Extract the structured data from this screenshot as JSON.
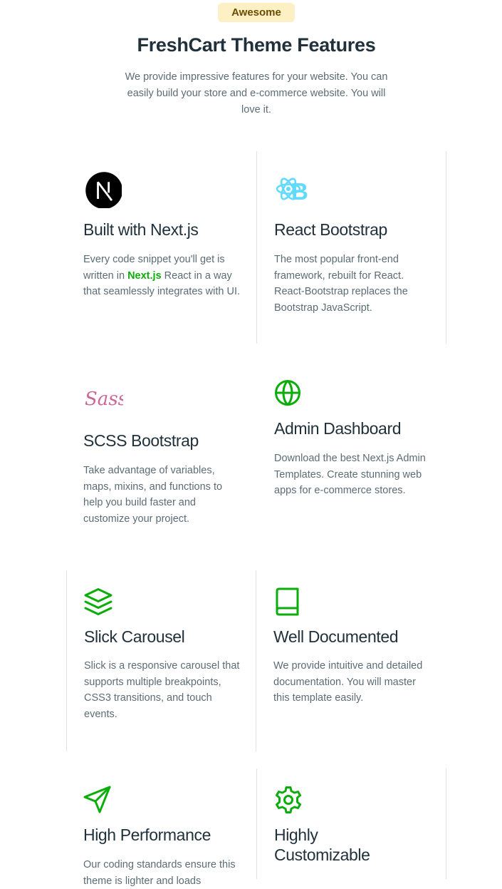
{
  "header": {
    "badge": "Awesome",
    "title": "FreshCart Theme Features",
    "subtitle": "We provide impressive features for your website. You can easily build your store and e-commerce website. You will love it."
  },
  "features": [
    {
      "icon": "nextjs-icon",
      "title": "Built with Next.js",
      "desc_before": "Every code snippet you'll get is written in ",
      "desc_highlight": "Next.js",
      "desc_after": " React in a way that seamlessly integrates with UI."
    },
    {
      "icon": "react-bootstrap-icon",
      "title": "React Bootstrap",
      "desc": "The most popular front-end framework, rebuilt for React. React-Bootstrap replaces the Bootstrap JavaScript."
    },
    {
      "icon": "sass-icon",
      "title": "SCSS Bootstrap",
      "desc": "Take advantage of variables, maps, mixins, and functions to help you build faster and customize your project."
    },
    {
      "icon": "globe-icon",
      "title": "Admin Dashboard",
      "desc": "Download the best Next.js Admin Templates. Create stunning web apps for e-commerce stores."
    },
    {
      "icon": "layers-icon",
      "title": "Slick Carousel",
      "desc": "Slick is a responsive carousel that supports multiple breakpoints, CSS3 transitions, and touch events."
    },
    {
      "icon": "book-icon",
      "title": "Well Documented",
      "desc": "We provide intuitive and detailed documentation. You will master this template easily."
    },
    {
      "icon": "send-icon",
      "title": "High Performance",
      "desc": "Our coding standards ensure this theme is lighter and loads"
    },
    {
      "icon": "gear-icon",
      "title": "Highly Customizable",
      "desc": ""
    }
  ],
  "colors": {
    "accent_green": "#0aad0a",
    "badge_bg": "#fdf0c4",
    "badge_text": "#6b4c00",
    "react_blue": "#61dafb",
    "sass_pink": "#cd6799"
  }
}
